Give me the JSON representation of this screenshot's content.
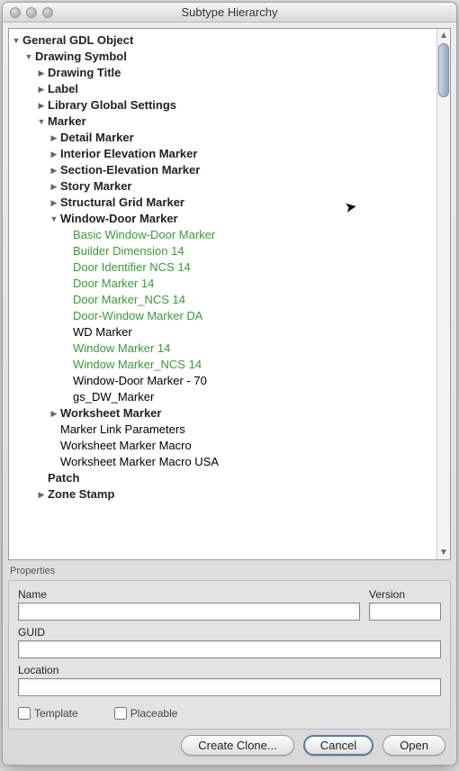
{
  "title": "Subtype Hierarchy",
  "tree": [
    {
      "indent": 0,
      "arrow": "down",
      "bold": true,
      "label": "General GDL Object"
    },
    {
      "indent": 1,
      "arrow": "down",
      "bold": true,
      "label": "Drawing Symbol"
    },
    {
      "indent": 2,
      "arrow": "right",
      "bold": true,
      "label": "Drawing Title"
    },
    {
      "indent": 2,
      "arrow": "right",
      "bold": true,
      "label": "Label"
    },
    {
      "indent": 2,
      "arrow": "right",
      "bold": true,
      "label": "Library Global Settings"
    },
    {
      "indent": 2,
      "arrow": "down",
      "bold": true,
      "label": "Marker"
    },
    {
      "indent": 3,
      "arrow": "right",
      "bold": true,
      "label": "Detail Marker"
    },
    {
      "indent": 3,
      "arrow": "right",
      "bold": true,
      "label": "Interior Elevation Marker"
    },
    {
      "indent": 3,
      "arrow": "right",
      "bold": true,
      "label": "Section-Elevation Marker"
    },
    {
      "indent": 3,
      "arrow": "right",
      "bold": true,
      "label": "Story Marker"
    },
    {
      "indent": 3,
      "arrow": "right",
      "bold": true,
      "label": "Structural Grid Marker"
    },
    {
      "indent": 3,
      "arrow": "down",
      "bold": true,
      "label": "Window-Door Marker"
    },
    {
      "indent": 4,
      "arrow": "none",
      "green": true,
      "label": "Basic Window-Door Marker"
    },
    {
      "indent": 4,
      "arrow": "none",
      "green": true,
      "label": "Builder Dimension 14"
    },
    {
      "indent": 4,
      "arrow": "none",
      "green": true,
      "label": "Door Identifier NCS 14"
    },
    {
      "indent": 4,
      "arrow": "none",
      "green": true,
      "label": "Door Marker 14"
    },
    {
      "indent": 4,
      "arrow": "none",
      "green": true,
      "label": "Door Marker_NCS 14"
    },
    {
      "indent": 4,
      "arrow": "none",
      "green": true,
      "label": "Door-Window Marker DA"
    },
    {
      "indent": 4,
      "arrow": "none",
      "label": "WD Marker"
    },
    {
      "indent": 4,
      "arrow": "none",
      "green": true,
      "label": "Window Marker 14"
    },
    {
      "indent": 4,
      "arrow": "none",
      "green": true,
      "label": "Window Marker_NCS 14"
    },
    {
      "indent": 4,
      "arrow": "none",
      "label": "Window-Door Marker - 70"
    },
    {
      "indent": 4,
      "arrow": "none",
      "label": "gs_DW_Marker"
    },
    {
      "indent": 3,
      "arrow": "right",
      "bold": true,
      "label": "Worksheet Marker"
    },
    {
      "indent": 3,
      "arrow": "none",
      "label": "Marker Link Parameters"
    },
    {
      "indent": 3,
      "arrow": "none",
      "label": "Worksheet Marker Macro"
    },
    {
      "indent": 3,
      "arrow": "none",
      "label": "Worksheet Marker Macro USA"
    },
    {
      "indent": 2,
      "arrow": "none",
      "bold": true,
      "label": "Patch"
    },
    {
      "indent": 2,
      "arrow": "right",
      "bold": true,
      "label": "Zone Stamp"
    }
  ],
  "properties": {
    "sectionLabel": "Properties",
    "nameLabel": "Name",
    "versionLabel": "Version",
    "guidLabel": "GUID",
    "locationLabel": "Location",
    "nameValue": "",
    "versionValue": "",
    "guidValue": "",
    "locationValue": "",
    "templateLabel": "Template",
    "placeableLabel": "Placeable"
  },
  "buttons": {
    "createClone": "Create Clone...",
    "cancel": "Cancel",
    "open": "Open"
  }
}
